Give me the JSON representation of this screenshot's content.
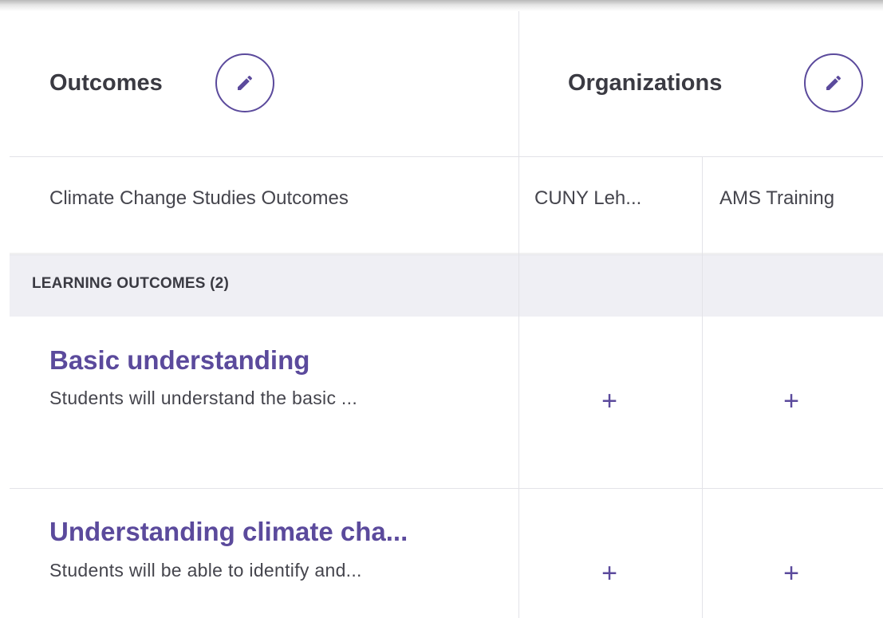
{
  "header": {
    "outcomes_title": "Outcomes",
    "organizations_title": "Organizations",
    "edit_icon": "pencil-icon"
  },
  "columns": {
    "outcome_set": "Climate Change Studies Outcomes",
    "organizations": [
      "CUNY Leh...",
      "AMS Training"
    ]
  },
  "section": {
    "label": "LEARNING OUTCOMES (2)"
  },
  "outcomes": [
    {
      "title": "Basic understanding",
      "description": "Students will understand the basic ..."
    },
    {
      "title": "Understanding climate cha...",
      "description": "Students will be able to identify and..."
    }
  ],
  "cell_action": "+",
  "colors": {
    "accent": "#5b4a9c",
    "text": "#3a3a42",
    "band": "#efeff4",
    "divider": "#e3e3e8"
  }
}
